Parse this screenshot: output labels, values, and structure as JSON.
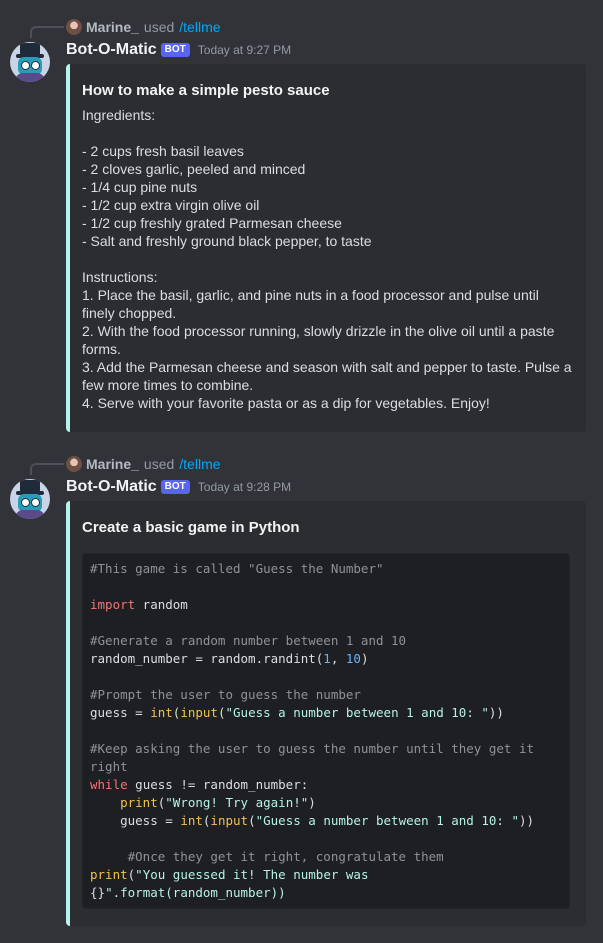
{
  "messages": [
    {
      "reply": {
        "user": "Marine_",
        "used": "used",
        "command": "/tellme"
      },
      "author": "Bot-O-Matic",
      "tag": "BOT",
      "timestamp": "Today at 9:27 PM",
      "embed": {
        "title": "How to make a simple pesto sauce",
        "lines": [
          "Ingredients:",
          "",
          "- 2 cups fresh basil leaves",
          "- 2 cloves garlic, peeled and minced",
          "- 1/4 cup pine nuts",
          "- 1/2 cup extra virgin olive oil",
          "- 1/2 cup freshly grated Parmesan cheese",
          "- Salt and freshly ground black pepper, to taste",
          "",
          "Instructions:",
          "1. Place the basil, garlic, and pine nuts in a food processor and pulse until finely chopped.",
          "2. With the food processor running, slowly drizzle in the olive oil until a paste forms.",
          "3. Add the Parmesan cheese and season with salt and pepper to taste. Pulse a few more times to combine.",
          "4. Serve with your favorite pasta or as a dip for vegetables. Enjoy!"
        ]
      }
    },
    {
      "reply": {
        "user": "Marine_",
        "used": "used",
        "command": "/tellme"
      },
      "author": "Bot-O-Matic",
      "tag": "BOT",
      "timestamp": "Today at 9:28 PM",
      "embed": {
        "title": "Create a basic game in Python",
        "code": [
          "#This game is called \"Guess the Number\"",
          "",
          "import random",
          "",
          "#Generate a random number between 1 and 10",
          "random_number = random.randint(1, 10)",
          "",
          "#Prompt the user to guess the number",
          "guess = int(input(\"Guess a number between 1 and 10: \"))",
          "",
          "#Keep asking the user to guess the number until they get it",
          "right",
          "while guess != random_number:",
          "    print(\"Wrong! Try again!\")",
          "    guess = int(input(\"Guess a number between 1 and 10: \"))",
          "",
          "     #Once they get it right, congratulate them",
          "print(\"You guessed it! The number was",
          "{}\".format(random_number))"
        ]
      }
    }
  ],
  "colors": {
    "accent": "#b5f3f0",
    "bot_tag": "#5865f2",
    "command": "#00a8fc"
  }
}
